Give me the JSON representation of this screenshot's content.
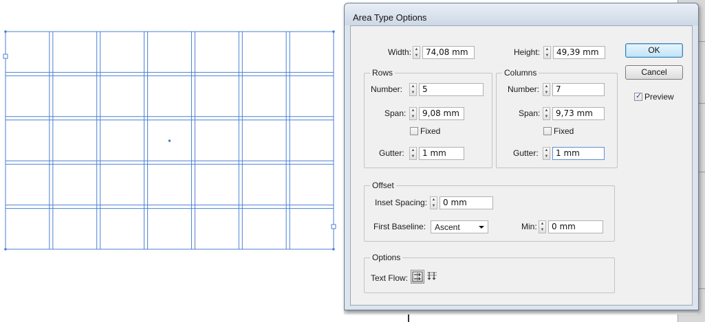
{
  "dialog": {
    "title": "Area Type Options",
    "width_label": "Width:",
    "width_value": "74,08 mm",
    "height_label": "Height:",
    "height_value": "49,39 mm",
    "ok_label": "OK",
    "cancel_label": "Cancel",
    "preview_label": "Preview",
    "preview_checked": true
  },
  "rows": {
    "title": "Rows",
    "number_label": "Number:",
    "number_value": "5",
    "span_label": "Span:",
    "span_value": "9,08 mm",
    "fixed_label": "Fixed",
    "fixed_checked": false,
    "gutter_label": "Gutter:",
    "gutter_value": "1 mm"
  },
  "columns": {
    "title": "Columns",
    "number_label": "Number:",
    "number_value": "7",
    "span_label": "Span:",
    "span_value": "9,73 mm",
    "fixed_label": "Fixed",
    "fixed_checked": false,
    "gutter_label": "Gutter:",
    "gutter_value": "1 mm"
  },
  "offset": {
    "title": "Offset",
    "inset_label": "Inset Spacing:",
    "inset_value": "0 mm",
    "baseline_label": "First Baseline:",
    "baseline_value": "Ascent",
    "min_label": "Min:",
    "min_value": "0 mm"
  },
  "options": {
    "title": "Options",
    "text_flow_label": "Text Flow:",
    "text_flow_selected": "rows-first"
  },
  "artboard": {
    "rows": 5,
    "columns": 7,
    "selection_color": "#4a7fd4"
  },
  "icons": [
    "spin-up-icon",
    "spin-down-icon",
    "checkmark-icon",
    "dropdown-caret-icon",
    "text-flow-by-rows-icon",
    "text-flow-by-columns-icon",
    "anchor-handle-icon",
    "center-point-icon"
  ]
}
